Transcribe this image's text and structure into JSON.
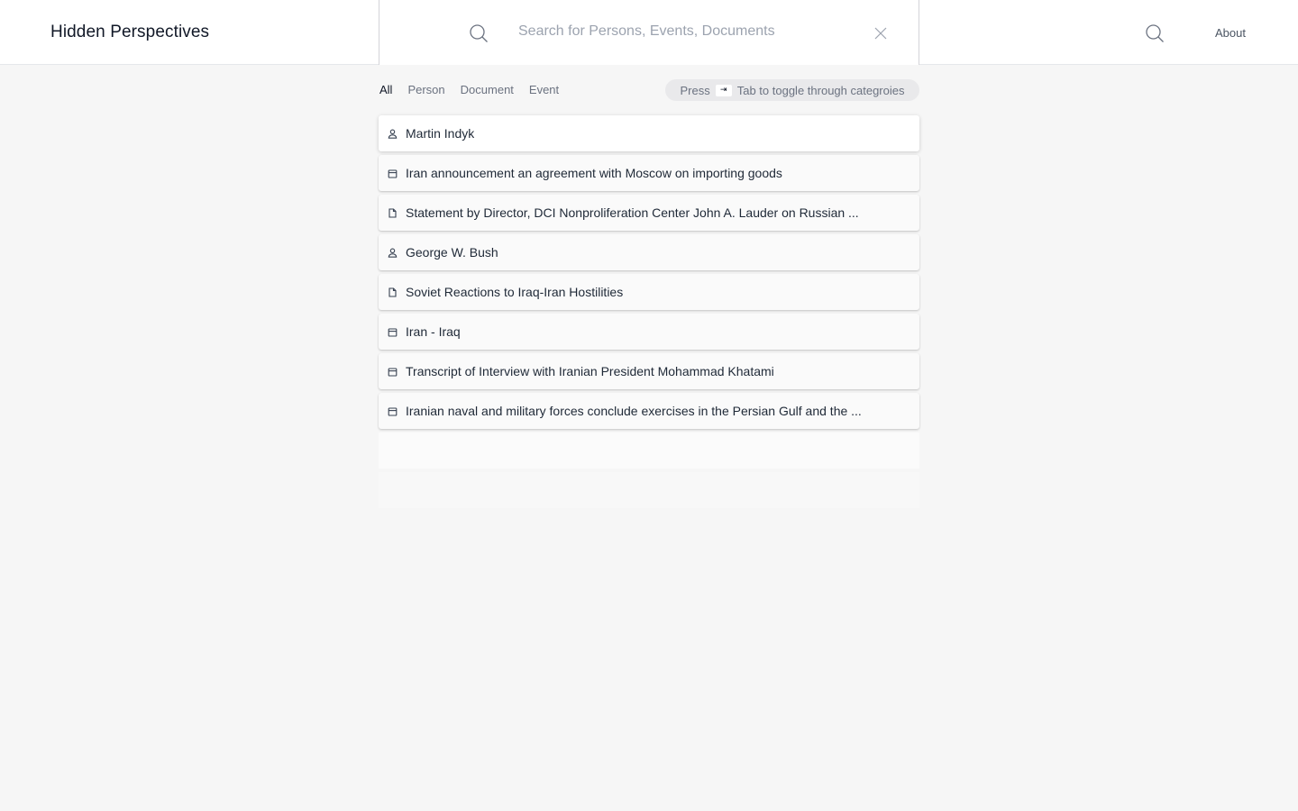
{
  "header": {
    "brand": "Hidden Perspectives",
    "search": {
      "placeholder": "Search for Persons, Events, Documents",
      "value": ""
    },
    "about_label": "About"
  },
  "filters": {
    "tabs": [
      {
        "label": "All",
        "active": true
      },
      {
        "label": "Person",
        "active": false
      },
      {
        "label": "Document",
        "active": false
      },
      {
        "label": "Event",
        "active": false
      }
    ],
    "hint": {
      "before": "Press",
      "key_icon": "tab-key-icon",
      "after": "Tab to toggle through categroies"
    }
  },
  "results": [
    {
      "type": "person",
      "icon": "person-icon",
      "title": "Martin Indyk",
      "selected": true
    },
    {
      "type": "event",
      "icon": "calendar-icon",
      "title": "Iran announcement an agreement with Moscow on importing goods"
    },
    {
      "type": "document",
      "icon": "document-icon",
      "title": "Statement by Director, DCI Nonproliferation Center John A. Lauder on Russian ..."
    },
    {
      "type": "person",
      "icon": "person-icon",
      "title": "George W. Bush"
    },
    {
      "type": "document",
      "icon": "document-icon",
      "title": "Soviet Reactions to Iraq-Iran Hostilities"
    },
    {
      "type": "event",
      "icon": "calendar-icon",
      "title": "Iran - Iraq"
    },
    {
      "type": "event",
      "icon": "calendar-icon",
      "title": "Transcript of Interview with Iranian President Mohammad Khatami"
    },
    {
      "type": "event",
      "icon": "calendar-icon",
      "title": "Iranian naval and military forces conclude exercises in the Persian Gulf and the ..."
    }
  ],
  "colors": {
    "background": "#f6f6f6",
    "text": "#1f2937",
    "muted": "#6b7280",
    "hint_bg": "#e9e9eb"
  }
}
